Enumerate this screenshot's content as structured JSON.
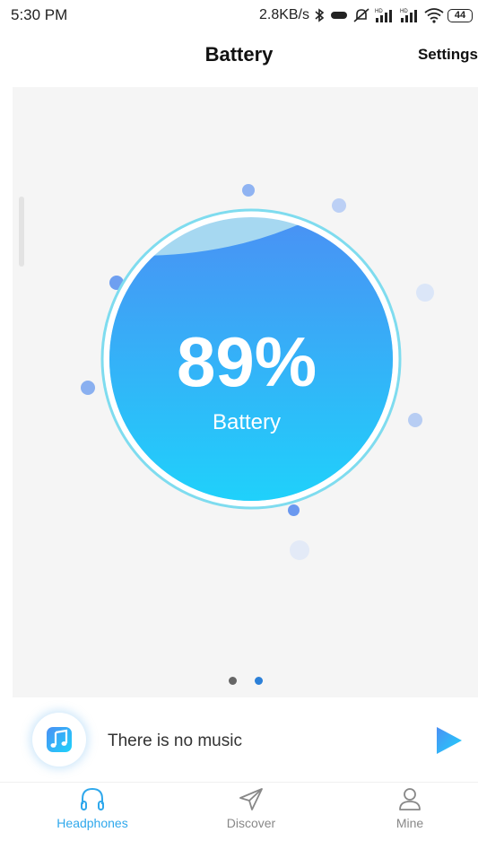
{
  "status_bar": {
    "time": "5:30 PM",
    "network_speed": "2.8KB/s",
    "battery_level": "44",
    "icons": [
      "bluetooth-icon",
      "vibrate-icon",
      "mute-icon",
      "hd-signal-icon",
      "hd-signal-icon",
      "wifi-icon",
      "battery-icon"
    ]
  },
  "header": {
    "title": "Battery",
    "settings_label": "Settings"
  },
  "battery": {
    "percent_text": "89%",
    "label": "Battery",
    "level": 0.89
  },
  "pager": {
    "count": 2,
    "active_index": 1
  },
  "player": {
    "icon": "music-note-icon",
    "status_text": "There is no music",
    "play_icon": "play-icon"
  },
  "bottom_nav": {
    "items": [
      {
        "label": "Headphones",
        "icon": "headphones-icon",
        "active": true
      },
      {
        "label": "Discover",
        "icon": "paper-plane-icon",
        "active": false
      },
      {
        "label": "Mine",
        "icon": "user-icon",
        "active": false
      }
    ]
  },
  "colors": {
    "accent": "#2fa8ec",
    "gradient_top": "#4b8ff4",
    "gradient_bottom": "#1ed3fb",
    "ring": "#7fdcef",
    "pager_inactive": "#666666",
    "pager_active": "#2c80d8",
    "nav_inactive": "#888888"
  }
}
